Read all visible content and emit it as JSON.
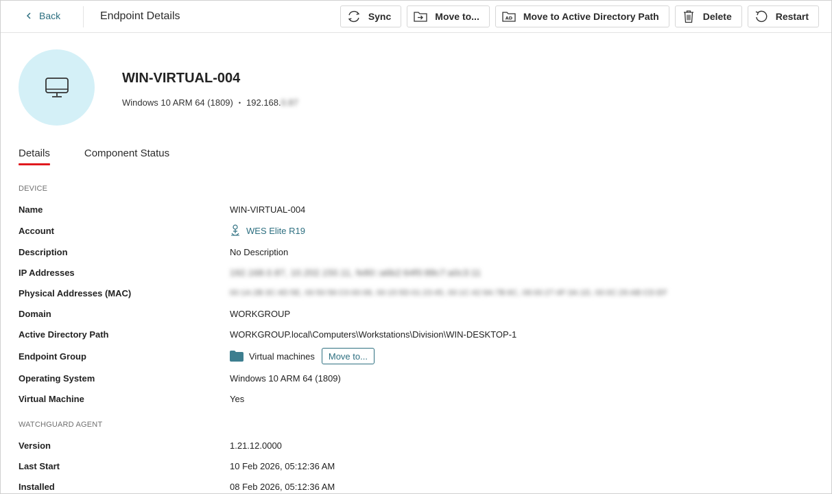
{
  "topbar": {
    "back_label": "Back",
    "title": "Endpoint Details",
    "actions": [
      {
        "label": "Sync",
        "icon": "sync-icon"
      },
      {
        "label": "Move to...",
        "icon": "move-to-icon"
      },
      {
        "label": "Move to Active Directory Path",
        "icon": "ad-icon"
      },
      {
        "label": "Delete",
        "icon": "trash-icon"
      },
      {
        "label": "Restart",
        "icon": "restart-icon"
      }
    ]
  },
  "header": {
    "device_name": "WIN-VIRTUAL-004",
    "os": "Windows 10 ARM 64 (1809)",
    "separator": "•",
    "ip_prefix": "192.168.",
    "ip_hidden": "0.87"
  },
  "tabs": [
    {
      "label": "Details",
      "active": true
    },
    {
      "label": "Component Status",
      "active": false
    }
  ],
  "device_section": {
    "label": "DEVICE",
    "name": {
      "key": "Name",
      "value": "WIN-VIRTUAL-004"
    },
    "account": {
      "key": "Account",
      "value": "WES Elite R19"
    },
    "description": {
      "key": "Description",
      "value": "No Description"
    },
    "ip_addresses": {
      "key": "IP Addresses",
      "value": "192.168.0.87, 10.202.150.11, fe80::a6b2:64f0:88c7:a0c3:11"
    },
    "mac": {
      "key": "Physical Addresses (MAC)",
      "value": "00:1A:2B:3C:4D:5E, 00:50:56:C0:00:08, 00:15:5D:01:23:45, 00:1C:42:9A:7B:6C, 08:00:27:4F:3A:1D, 00:0C:29:AB:CD:EF"
    },
    "domain": {
      "key": "Domain",
      "value": "WORKGROUP"
    },
    "ad_path": {
      "key": "Active Directory Path",
      "value": "WORKGROUP.local\\Computers\\Workstations\\Division\\WIN-DESKTOP-1"
    },
    "group": {
      "key": "Endpoint Group",
      "value": "Virtual machines",
      "move_label": "Move to..."
    },
    "os": {
      "key": "Operating System",
      "value": "Windows 10 ARM 64 (1809)"
    },
    "vm": {
      "key": "Virtual Machine",
      "value": "Yes"
    }
  },
  "agent_section": {
    "label": "WATCHGUARD AGENT",
    "version": {
      "key": "Version",
      "value": "1.21.12.0000"
    },
    "last_start": {
      "key": "Last Start",
      "value": "10 Feb 2026, 05:12:36 AM"
    },
    "installed": {
      "key": "Installed",
      "value": "08 Feb 2026, 05:12:36 AM"
    }
  },
  "colors": {
    "accent": "#2d6f80",
    "tab_underline": "#e0191e",
    "avatar_bg": "#d4f0f7"
  }
}
